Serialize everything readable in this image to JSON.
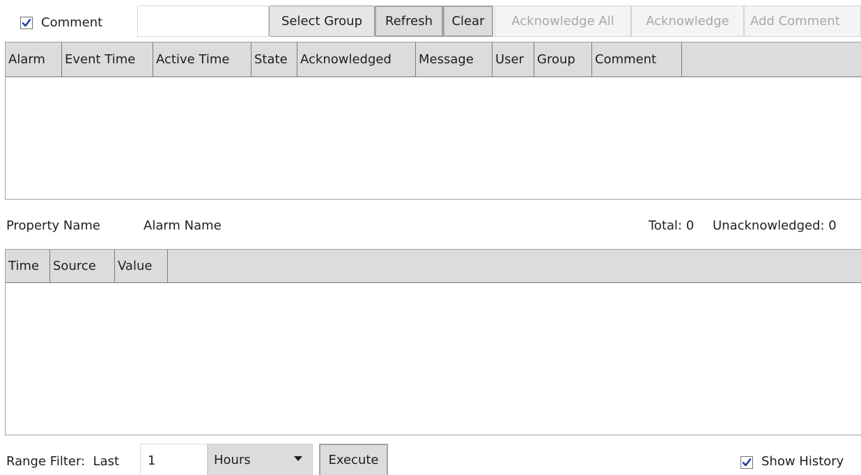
{
  "toolbar": {
    "comment_checkbox": {
      "label": "Comment",
      "checked": true
    },
    "comment_input": {
      "value": ""
    },
    "buttons": [
      {
        "label": "Select Group",
        "enabled": true
      },
      {
        "label": "Refresh",
        "enabled": true
      },
      {
        "label": "Clear",
        "enabled": true
      },
      {
        "label": "Acknowledge All",
        "enabled": false
      },
      {
        "label": "Acknowledge",
        "enabled": false
      },
      {
        "label": "Add Comment",
        "enabled": false
      }
    ]
  },
  "alarm_grid": {
    "columns": [
      "Alarm",
      "Event Time",
      "Active Time",
      "State",
      "Acknowledged",
      "Message",
      "User",
      "Group",
      "Comment",
      ""
    ],
    "rows": []
  },
  "status_bar": {
    "property_name_label": "Property Name",
    "alarm_name_label": "Alarm Name",
    "total_label": "Total: 0",
    "unacknowledged_label": "Unacknowledged: 0"
  },
  "history_grid": {
    "columns": [
      "Time",
      "Source",
      "Value",
      ""
    ],
    "rows": []
  },
  "range_filter": {
    "label": "Range Filter:  Last",
    "value": "1",
    "unit": "Hours",
    "execute_label": "Execute",
    "show_history": {
      "label": "Show History",
      "checked": true
    }
  },
  "colors": {
    "header_bg": "#dcdcdc",
    "check_mark": "#1c3fa8",
    "disabled_text": "#a8a8a8"
  }
}
